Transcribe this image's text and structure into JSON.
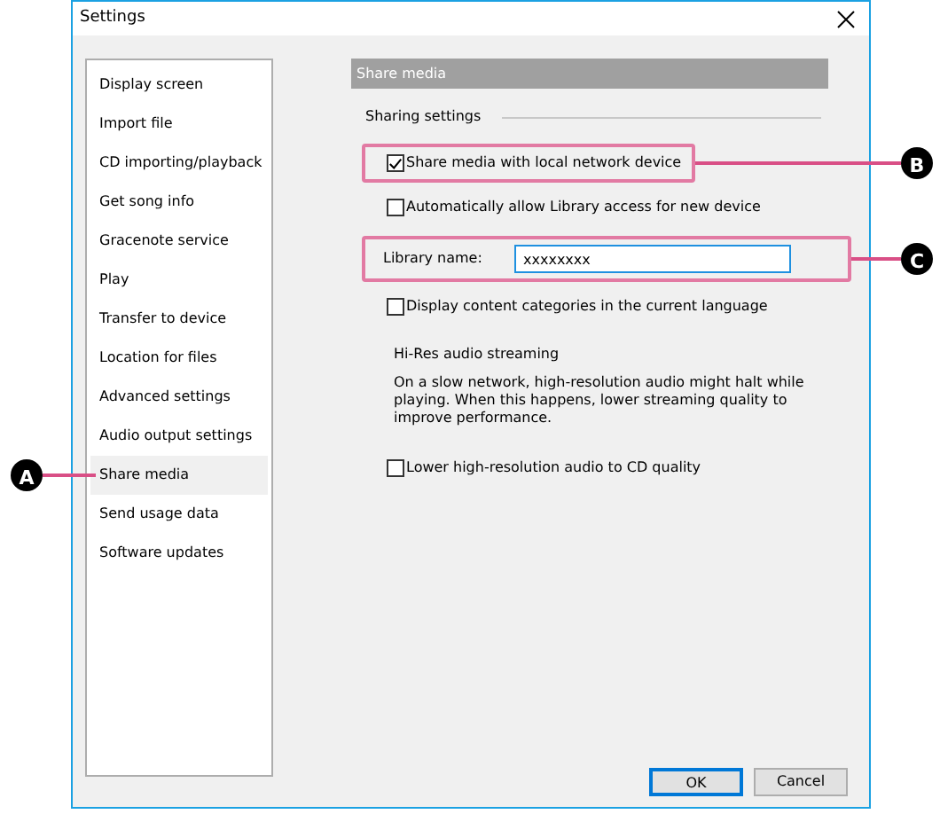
{
  "window": {
    "title": "Settings"
  },
  "sidebar": {
    "items": [
      {
        "label": "Display screen",
        "selected": false
      },
      {
        "label": "Import file",
        "selected": false
      },
      {
        "label": "CD importing/playback",
        "selected": false
      },
      {
        "label": "Get song info",
        "selected": false
      },
      {
        "label": "Gracenote service",
        "selected": false
      },
      {
        "label": "Play",
        "selected": false
      },
      {
        "label": "Transfer to device",
        "selected": false
      },
      {
        "label": "Location for files",
        "selected": false
      },
      {
        "label": "Advanced settings",
        "selected": false
      },
      {
        "label": "Audio output settings",
        "selected": false
      },
      {
        "label": "Share media",
        "selected": true,
        "callout": "A"
      },
      {
        "label": "Send usage data",
        "selected": false
      },
      {
        "label": "Software updates",
        "selected": false
      }
    ]
  },
  "panel": {
    "header": "Share media",
    "group_title": "Sharing settings",
    "controls": [
      {
        "kind": "checkbox",
        "label": "Share media with local network device",
        "checked": true,
        "callout": "B"
      },
      {
        "kind": "checkbox",
        "label": "Automatically allow Library access for new device",
        "checked": false
      },
      {
        "kind": "field",
        "label": "Library name:",
        "value": "xxxxxxxx",
        "callout": "C"
      },
      {
        "kind": "checkbox",
        "label": "Display content categories in the current language",
        "checked": false
      },
      {
        "kind": "heading",
        "text": "Hi-Res audio streaming"
      },
      {
        "kind": "paragraph",
        "text": "On a slow network, high-resolution audio might halt while playing. When this happens, lower streaming quality to improve performance."
      },
      {
        "kind": "checkbox",
        "label": "Lower high-resolution audio to CD quality",
        "checked": false
      }
    ]
  },
  "buttons": [
    {
      "label": "OK",
      "default": true
    },
    {
      "label": "Cancel",
      "default": false
    }
  ]
}
